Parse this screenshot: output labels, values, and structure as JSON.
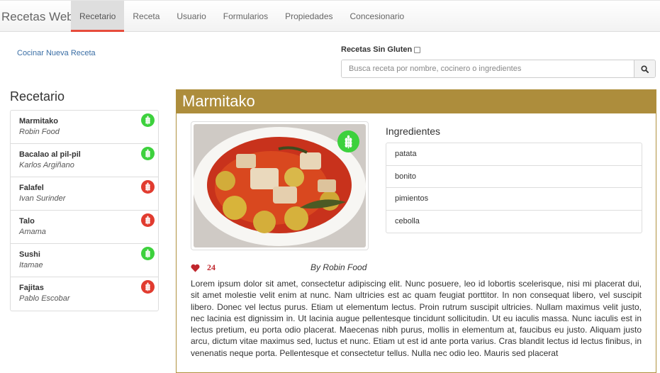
{
  "navbar": {
    "brand": "Recetas Web",
    "items": [
      {
        "label": "Recetario",
        "active": true
      },
      {
        "label": "Receta"
      },
      {
        "label": "Usuario"
      },
      {
        "label": "Formularios"
      },
      {
        "label": "Propiedades"
      },
      {
        "label": "Concesionario"
      }
    ]
  },
  "actions": {
    "new_recipe": "Cocinar Nueva Receta"
  },
  "filter": {
    "gluten_free_label": "Recetas Sin Gluten",
    "gluten_free_checked": false
  },
  "search": {
    "placeholder": "Busca receta por nombre, cocinero o ingredientes",
    "icon": "search-icon"
  },
  "sidebar": {
    "title": "Recetario",
    "recipes": [
      {
        "name": "Marmitako",
        "cook": "Robin Food",
        "gluten_free": true
      },
      {
        "name": "Bacalao al pil-pil",
        "cook": "Karlos Argiñano",
        "gluten_free": true
      },
      {
        "name": "Falafel",
        "cook": "Ivan Surinder",
        "gluten_free": false
      },
      {
        "name": "Talo",
        "cook": "Amama",
        "gluten_free": false
      },
      {
        "name": "Sushi",
        "cook": "Itamae",
        "gluten_free": true
      },
      {
        "name": "Fajitas",
        "cook": "Pablo Escobar",
        "gluten_free": false
      }
    ]
  },
  "detail": {
    "title": "Marmitako",
    "gluten_free": true,
    "ingredients_title": "Ingredientes",
    "ingredients": [
      "patata",
      "bonito",
      "pimientos",
      "cebolla"
    ],
    "likes": "24",
    "author": "By Robin Food",
    "description": "Lorem ipsum dolor sit amet, consectetur adipiscing elit. Nunc posuere, leo id lobortis scelerisque, nisi mi placerat dui, sit amet molestie velit enim at nunc. Nam ultricies est ac quam feugiat porttitor. In non consequat libero, vel suscipit libero. Donec vel lectus purus. Etiam ut elementum lectus. Proin rutrum suscipit ultricies. Nullam maximus velit justo, nec lacinia est dignissim in. Ut lacinia augue pellentesque tincidunt sollicitudin. Ut eu iaculis massa. Nunc iaculis est in lectus pretium, eu porta odio placerat. Maecenas nibh purus, mollis in elementum at, faucibus eu justo. Aliquam justo arcu, dictum vitae maximus sed, luctus et nunc. Etiam ut est id ante porta varius. Cras blandit lectus id lectus finibus, in venenatis neque porta. Pellentesque et consectetur tellus. Nulla nec odio leo. Mauris sed placerat"
  },
  "colors": {
    "accent": "#ad8d3c",
    "gluten_free": "#3dd13d",
    "contains_gluten": "#e13b2f",
    "active_tab": "#e74c3c",
    "like": "#c0262d"
  }
}
